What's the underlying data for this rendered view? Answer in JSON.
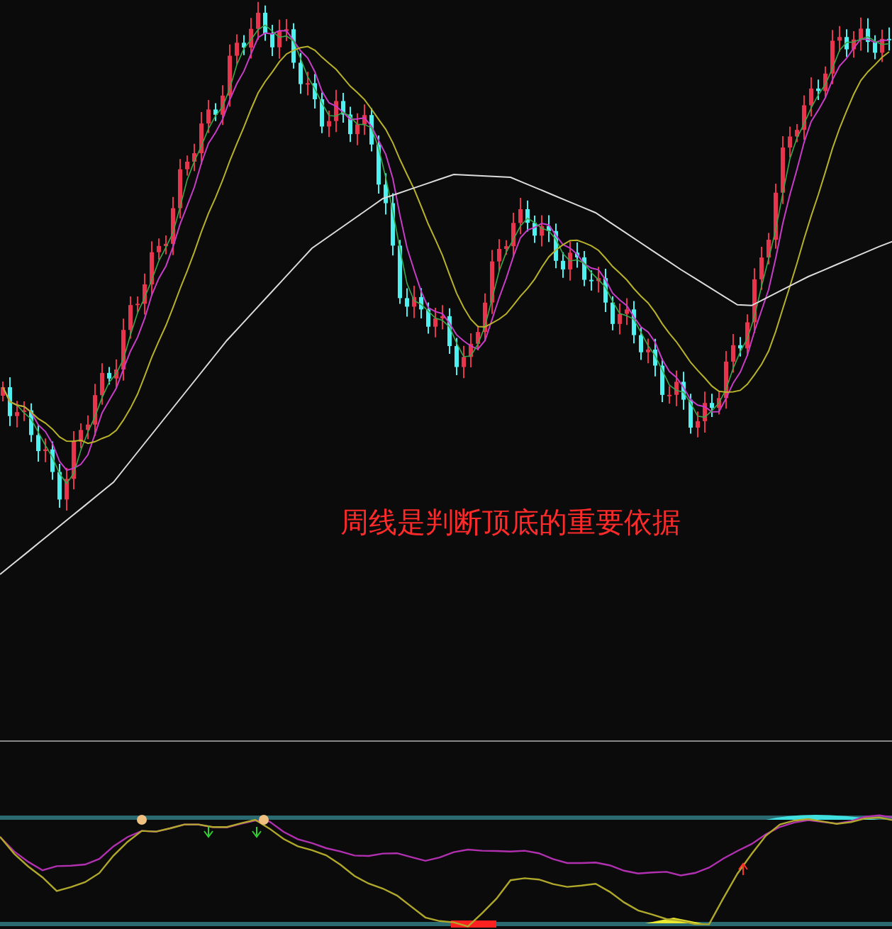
{
  "caption": "周线是判断顶底的重要依据"
}
